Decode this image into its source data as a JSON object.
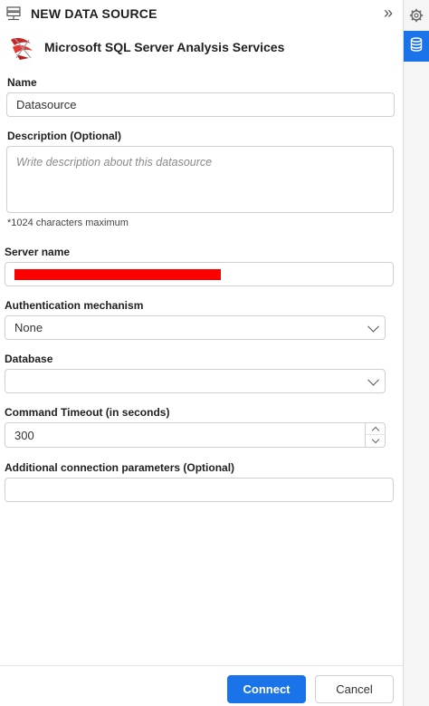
{
  "header": {
    "title": "NEW DATA SOURCE",
    "collapse_glyph": "»",
    "icon": "server-icon"
  },
  "source": {
    "name": "Microsoft SQL Server Analysis Services",
    "icon": "sql-server-icon"
  },
  "form": {
    "name_label": "Name",
    "name_value": "Datasource",
    "description_label": "Description (Optional)",
    "description_placeholder": "Write description about this datasource",
    "description_hint": "*1024 characters maximum",
    "server_label": "Server name",
    "server_value": "",
    "auth_label": "Authentication mechanism",
    "auth_value": "None",
    "database_label": "Database",
    "database_value": "",
    "timeout_label": "Command Timeout (in seconds)",
    "timeout_value": "300",
    "params_label": "Additional connection parameters (Optional)",
    "params_value": ""
  },
  "buttons": {
    "connect": "Connect",
    "cancel": "Cancel"
  },
  "rail": {
    "settings_icon": "gear-icon",
    "database_icon": "database-icon"
  },
  "colors": {
    "accent": "#1a73e8",
    "redaction": "#ff0000"
  }
}
